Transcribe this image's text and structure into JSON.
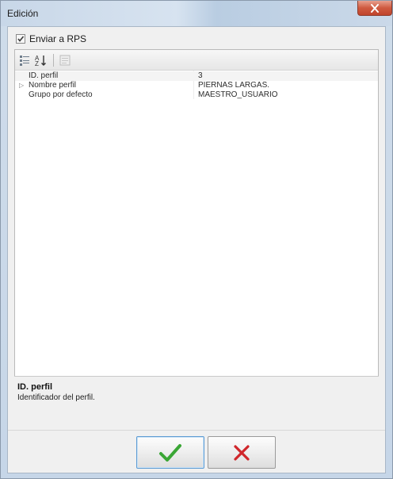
{
  "window": {
    "title": "Edición"
  },
  "options": {
    "send_rps_label": "Enviar a RPS",
    "send_rps_checked": true
  },
  "toolbar": {
    "buttons": [
      "categorized-icon",
      "alphabetical-sort-icon",
      "property-pages-icon"
    ]
  },
  "properties": [
    {
      "name": "ID. perfil",
      "value": "3",
      "expandable": false,
      "selected": true
    },
    {
      "name": "Nombre perfil",
      "value": "PIERNAS LARGAS.",
      "expandable": true,
      "selected": false
    },
    {
      "name": "Grupo por defecto",
      "value": "MAESTRO_USUARIO",
      "expandable": false,
      "selected": false
    }
  ],
  "help": {
    "title": "ID. perfil",
    "description": "Identificador del perfil."
  },
  "buttons": {
    "ok_icon": "checkmark-icon",
    "cancel_icon": "x-icon"
  },
  "colors": {
    "ok_green": "#3aa635",
    "cancel_red": "#d0262b",
    "close_red": "#c0442c"
  }
}
